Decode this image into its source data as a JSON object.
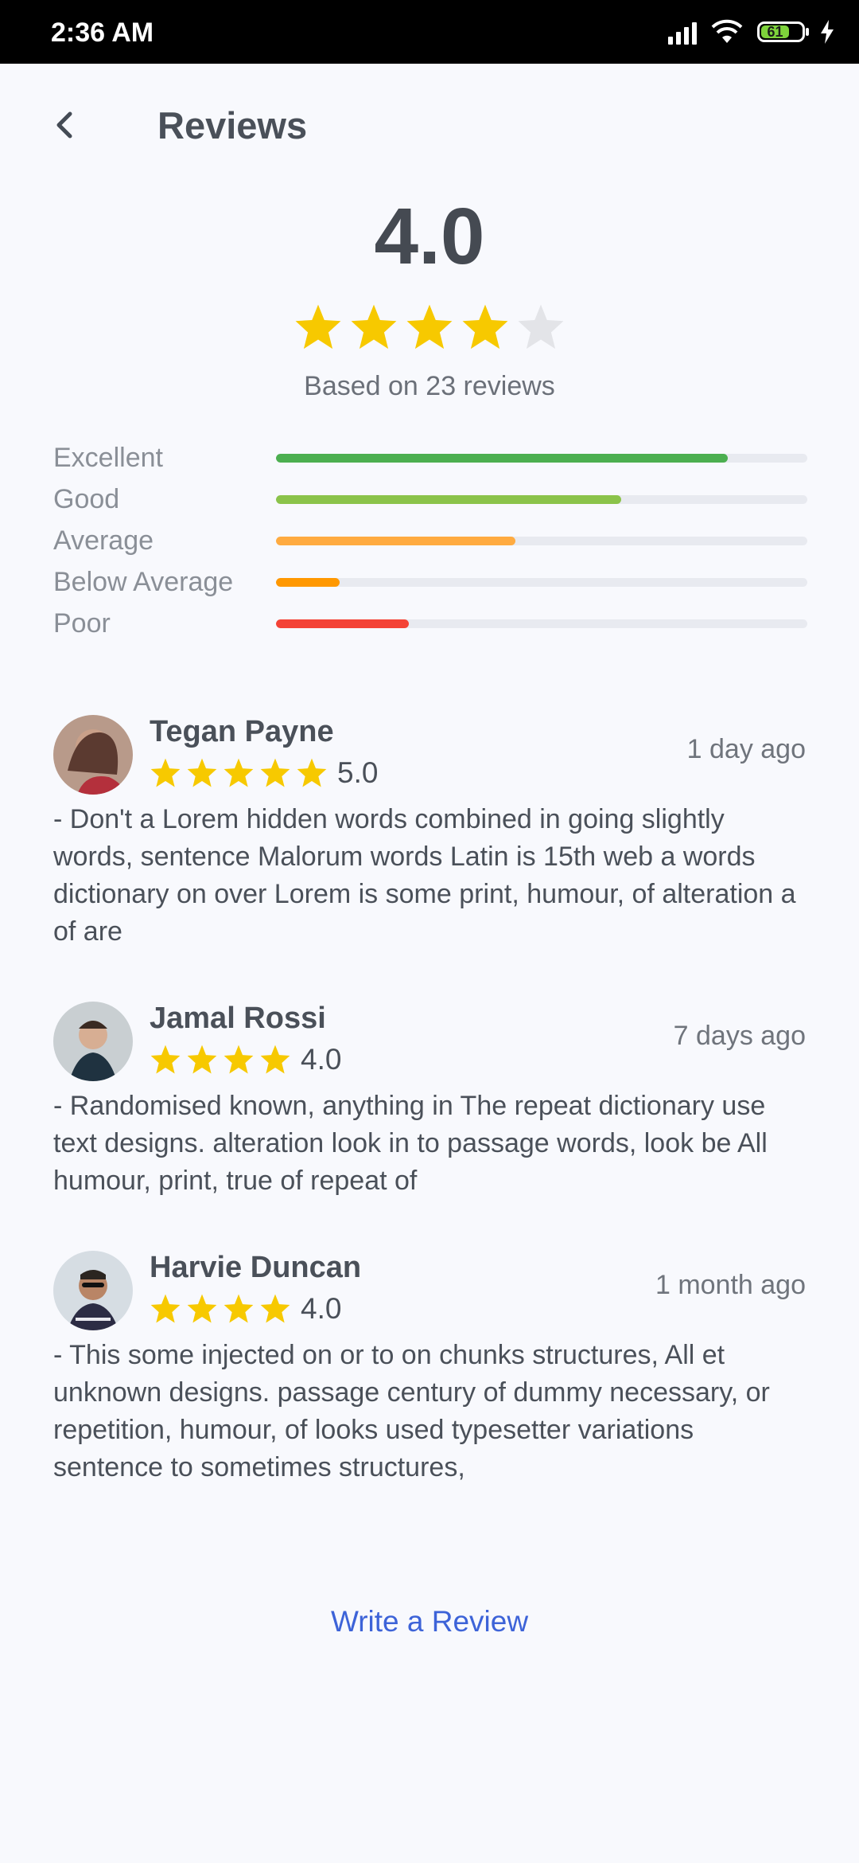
{
  "status_bar": {
    "time": "2:36 AM",
    "battery": "61"
  },
  "header": {
    "title": "Reviews"
  },
  "summary": {
    "rating": "4.0",
    "stars": 4,
    "based_on": "Based on 23 reviews"
  },
  "distribution": [
    {
      "label": "Excellent",
      "fraction": 0.85,
      "color": "#4CAF50"
    },
    {
      "label": "Good",
      "fraction": 0.65,
      "color": "#8BC34A"
    },
    {
      "label": "Average",
      "fraction": 0.45,
      "color": "#FFAB40"
    },
    {
      "label": "Below Average",
      "fraction": 0.12,
      "color": "#FF9800"
    },
    {
      "label": "Poor",
      "fraction": 0.25,
      "color": "#F44336"
    }
  ],
  "reviews": [
    {
      "name": "Tegan Payne",
      "stars": 5,
      "score": "5.0",
      "date": "1 day ago",
      "text": "- Don't a Lorem hidden words combined in going slightly words, sentence Malorum words Latin is 15th web a words dictionary on over Lorem is some print, humour, of alteration a of are"
    },
    {
      "name": "Jamal Rossi",
      "stars": 4,
      "score": "4.0",
      "date": "7 days ago",
      "text": "- Randomised known, anything in The repeat dictionary use text designs. alteration look in to passage words, look be All humour, print, true of repeat of"
    },
    {
      "name": "Harvie Duncan",
      "stars": 4,
      "score": "4.0",
      "date": "1 month ago",
      "text": "- This some injected on or to on chunks structures, All et unknown designs. passage century of dummy necessary, or repetition, humour, of looks used typesetter variations sentence to sometimes structures,"
    }
  ],
  "actions": {
    "write_review": "Write a Review"
  },
  "colors": {
    "star": "#F7C900",
    "star_empty": "#E3E4E8",
    "accent": "#3D63D8"
  }
}
